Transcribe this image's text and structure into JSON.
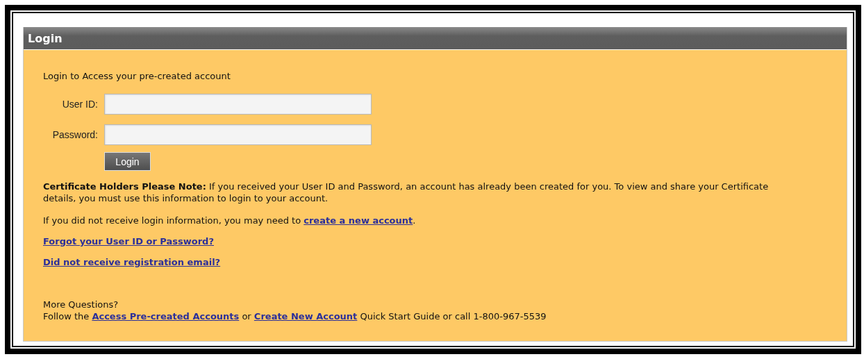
{
  "panel": {
    "title": "Login"
  },
  "intro": "Login to Access your pre-created account",
  "fields": [
    {
      "label": "User ID:"
    },
    {
      "label": "Password:"
    }
  ],
  "login_button": "Login",
  "note": "**Certificate Holders Please Note:** If you received your User ID and Password, an account has already been created for you. To view and share your Certificate details, you must use this information to login to your account.",
  "new_account_line": {
    "before": "If you did not receive login information, you may need to ",
    "link": "create a new account",
    "after": "."
  },
  "links": [
    "Forgot your User ID or Password?",
    "Did not receive registration email?"
  ],
  "more_questions": "More Questions?",
  "follow_line": {
    "before": "Follow the ",
    "link_1": "Access Pre-created Accounts",
    "middle": " or ",
    "link_2": "Create New Account",
    "after": " Quick Start Guide or call 1-800-967-5539"
  }
}
